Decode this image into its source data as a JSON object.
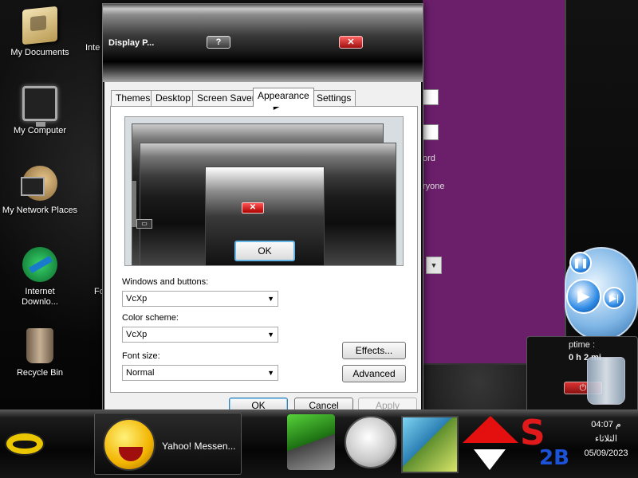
{
  "desktop": {
    "icons": [
      {
        "label": "My Documents"
      },
      {
        "label": "My Computer"
      },
      {
        "label": "My Network Places"
      },
      {
        "label": "Internet Downlo..."
      },
      {
        "label": "Recycle Bin"
      }
    ],
    "partial_labels": [
      "Inte",
      "Fo"
    ]
  },
  "background_window": {
    "text_lines": [
      "ord",
      "ryone"
    ]
  },
  "uptime_widget": {
    "label": "ptime :",
    "value": "0 h 2 mi"
  },
  "dialog": {
    "title": "Display P...",
    "help_button": "?",
    "close_button": "✕",
    "tabs": [
      {
        "label": "Themes",
        "active": false
      },
      {
        "label": "Desktop",
        "active": false
      },
      {
        "label": "Screen Saver",
        "active": false
      },
      {
        "label": "Appearance",
        "active": true
      },
      {
        "label": "Settings",
        "active": false
      }
    ],
    "preview": {
      "ok_label": "OK"
    },
    "windows_and_buttons": {
      "label": "Windows and buttons:",
      "value": "VcXp"
    },
    "color_scheme": {
      "label": "Color scheme:",
      "value": "VcXp"
    },
    "font_size": {
      "label": "Font size:",
      "value": "Normal"
    },
    "effects_button": "Effects...",
    "advanced_button": "Advanced",
    "ok_button": "OK",
    "cancel_button": "Cancel",
    "apply_button": "Apply"
  },
  "taskbar": {
    "task_item_label": "Yahoo! Messen...",
    "clock": {
      "time": "04:07 م",
      "day": "الثلاثاء",
      "date": "05/09/2023"
    }
  },
  "colors": {
    "purple_window": "#6b1f6b",
    "close_red": "#c41414",
    "focus_blue": "#63b6e6"
  }
}
